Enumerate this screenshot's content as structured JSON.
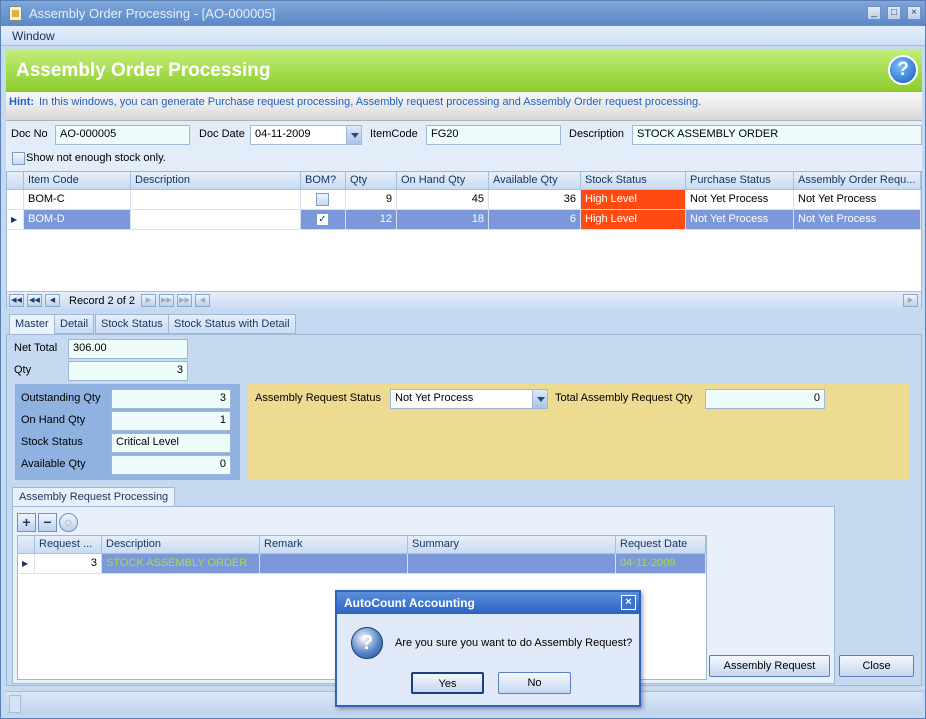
{
  "window": {
    "title": "Assembly Order Processing - [AO-000005]"
  },
  "menu": {
    "window": "Window"
  },
  "banner": {
    "title": "Assembly Order Processing"
  },
  "hint": {
    "label": "Hint:",
    "text": "In this windows, you can generate Purchase request processing, Assembly request processing and Assembly Order request processing."
  },
  "header": {
    "doc_no_label": "Doc No",
    "doc_no": "AO-000005",
    "doc_date_label": "Doc Date",
    "doc_date": "04-11-2009",
    "item_code_label": "ItemCode",
    "item_code": "FG20",
    "description_label": "Description",
    "description": "STOCK ASSEMBLY ORDER",
    "show_not_enough_label": "Show not enough stock only."
  },
  "grid1": {
    "columns": [
      "Item Code",
      "Description",
      "BOM?",
      "Qty",
      "On Hand Qty",
      "Available Qty",
      "Stock Status",
      "Purchase Status",
      "Assembly Order Requ..."
    ],
    "rows": [
      {
        "item_code": "BOM-C",
        "description": "",
        "bom": false,
        "qty": "9",
        "on_hand": "45",
        "available": "36",
        "stock_status": "High Level",
        "purchase_status": "Not Yet Process",
        "assembly_status": "Not Yet Process"
      },
      {
        "item_code": "BOM-D",
        "description": "",
        "bom": true,
        "qty": "12",
        "on_hand": "18",
        "available": "6",
        "stock_status": "High Level",
        "purchase_status": "Not Yet Process",
        "assembly_status": "Not Yet Process"
      }
    ],
    "record_text": "Record 2 of 2"
  },
  "tabs": [
    "Master",
    "Detail",
    "Stock Status",
    "Stock Status with Detail"
  ],
  "master": {
    "net_total_label": "Net Total",
    "net_total": "306.00",
    "qty_label": "Qty",
    "qty": "3",
    "outstanding_label": "Outstanding Qty",
    "outstanding": "3",
    "on_hand_label": "On Hand Qty",
    "on_hand": "1",
    "stock_status_label": "Stock Status",
    "stock_status": "Critical Level",
    "available_label": "Available Qty",
    "available": "0",
    "assembly_request_status_label": "Assembly Request Status",
    "assembly_request_status": "Not Yet Process",
    "total_assembly_request_qty_label": "Total Assembly Request Qty",
    "total_assembly_request_qty": "0"
  },
  "sub_tab": "Assembly Request Processing",
  "grid2": {
    "columns": [
      "Request ...",
      "Description",
      "Remark",
      "Summary",
      "Request Date"
    ],
    "rows": [
      {
        "request": "3",
        "description": "STOCK ASSEMBLY ORDER",
        "remark": "",
        "summary": "",
        "date": "04-11-2009"
      }
    ]
  },
  "buttons": {
    "assembly_request": "Assembly Request",
    "close": "Close"
  },
  "dialog": {
    "title": "AutoCount Accounting",
    "message": "Are you sure you want to do Assembly Request?",
    "yes": "Yes",
    "no": "No"
  },
  "colors": {
    "banner": "#8bcb2a",
    "high_level": "#ff4b12",
    "selected_row": "#7b98d8",
    "accent": "#2a63c0"
  }
}
